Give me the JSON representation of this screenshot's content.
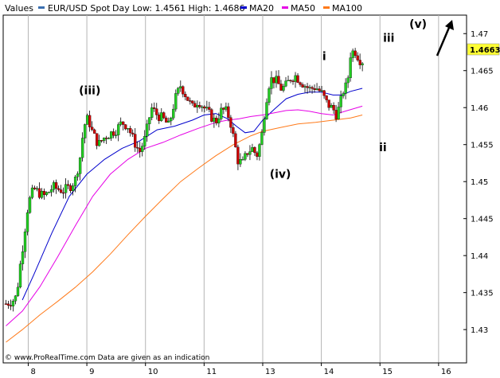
{
  "header": {
    "values_label": "Values",
    "symbol": "EUR/USD Spot",
    "day_low_high": "Day Low: 1.4561 High: 1.4686",
    "ma20_label": "MA20",
    "ma50_label": "MA50",
    "ma100_label": "MA100"
  },
  "colors": {
    "symbol": "#3a6fb0",
    "ma20": "#0000cc",
    "ma50": "#e600e6",
    "ma100": "#ff7a1a",
    "bull": "#22cc22",
    "bear": "#cc0000",
    "wick": "#000000",
    "last_price_bg": "#ffff33"
  },
  "last_price": "1.4663",
  "copyright": "© www.ProRealTime.com Data are given as an indication",
  "chart_data": {
    "type": "candlestick",
    "ylim": [
      1.4255,
      1.4725
    ],
    "y_ticks": [
      "1.47",
      "1.465",
      "1.46",
      "1.455",
      "1.45",
      "1.445",
      "1.44",
      "1.435",
      "1.43"
    ],
    "x_ticks": [
      "8",
      "9",
      "10",
      "11",
      "13",
      "14",
      "15",
      "16"
    ],
    "x_tick_positions": [
      8,
      9,
      10,
      11,
      12,
      13,
      14,
      15
    ],
    "x_domain": [
      7.6,
      15.45
    ],
    "annotations": [
      {
        "text": "(iii)",
        "x": 9.05,
        "y": 1.4618
      },
      {
        "text": "i",
        "x": 13.05,
        "y": 1.4664
      },
      {
        "text": "(iv)",
        "x": 12.3,
        "y": 1.4505
      },
      {
        "text": "iii",
        "x": 14.15,
        "y": 1.4689
      },
      {
        "text": "ii",
        "x": 14.05,
        "y": 1.4541
      },
      {
        "text": "(v)",
        "x": 14.65,
        "y": 1.4708
      }
    ],
    "candle_anchors": [
      [
        7.62,
        1.4335
      ],
      [
        7.72,
        1.4338
      ],
      [
        7.8,
        1.4345
      ],
      [
        7.86,
        1.4385
      ],
      [
        7.92,
        1.442
      ],
      [
        7.98,
        1.446
      ],
      [
        8.04,
        1.448
      ],
      [
        8.1,
        1.449
      ],
      [
        8.18,
        1.4485
      ],
      [
        8.26,
        1.448
      ],
      [
        8.34,
        1.4485
      ],
      [
        8.42,
        1.4493
      ],
      [
        8.5,
        1.449
      ],
      [
        8.6,
        1.4488
      ],
      [
        8.7,
        1.4492
      ],
      [
        8.8,
        1.4502
      ],
      [
        8.88,
        1.453
      ],
      [
        8.95,
        1.4575
      ],
      [
        9.02,
        1.4586
      ],
      [
        9.1,
        1.4565
      ],
      [
        9.2,
        1.455
      ],
      [
        9.3,
        1.456
      ],
      [
        9.4,
        1.4565
      ],
      [
        9.5,
        1.457
      ],
      [
        9.6,
        1.458
      ],
      [
        9.7,
        1.4575
      ],
      [
        9.8,
        1.4555
      ],
      [
        9.9,
        1.454
      ],
      [
        10.0,
        1.456
      ],
      [
        10.1,
        1.46
      ],
      [
        10.2,
        1.459
      ],
      [
        10.3,
        1.4585
      ],
      [
        10.4,
        1.4575
      ],
      [
        10.5,
        1.461
      ],
      [
        10.6,
        1.463
      ],
      [
        10.7,
        1.4615
      ],
      [
        10.8,
        1.46
      ],
      [
        10.9,
        1.461
      ],
      [
        11.0,
        1.46
      ],
      [
        11.1,
        1.459
      ],
      [
        11.2,
        1.458
      ],
      [
        11.28,
        1.4595
      ],
      [
        11.36,
        1.4597
      ],
      [
        11.44,
        1.4585
      ],
      [
        11.5,
        1.456
      ],
      [
        11.58,
        1.4528
      ],
      [
        11.66,
        1.4525
      ],
      [
        11.74,
        1.454
      ],
      [
        11.82,
        1.4545
      ],
      [
        11.9,
        1.4535
      ],
      [
        11.98,
        1.456
      ],
      [
        12.04,
        1.46
      ],
      [
        12.1,
        1.463
      ],
      [
        12.16,
        1.464
      ],
      [
        12.24,
        1.4635
      ],
      [
        12.32,
        1.4625
      ],
      [
        12.4,
        1.463
      ],
      [
        12.48,
        1.464
      ],
      [
        12.56,
        1.4643
      ],
      [
        12.64,
        1.4636
      ],
      [
        12.72,
        1.463
      ],
      [
        12.8,
        1.4625
      ],
      [
        12.9,
        1.4628
      ],
      [
        13.0,
        1.462
      ],
      [
        13.1,
        1.4605
      ],
      [
        13.2,
        1.4598
      ],
      [
        13.26,
        1.459
      ],
      [
        13.32,
        1.4605
      ],
      [
        13.38,
        1.4625
      ],
      [
        13.44,
        1.463
      ],
      [
        13.5,
        1.4675
      ],
      [
        13.58,
        1.4676
      ],
      [
        13.65,
        1.4665
      ],
      [
        13.7,
        1.4663
      ]
    ],
    "series": [
      {
        "name": "MA20",
        "points": [
          [
            7.9,
            1.434
          ],
          [
            8.1,
            1.4375
          ],
          [
            8.4,
            1.443
          ],
          [
            8.7,
            1.448
          ],
          [
            9.0,
            1.451
          ],
          [
            9.3,
            1.453
          ],
          [
            9.6,
            1.4545
          ],
          [
            9.9,
            1.4555
          ],
          [
            10.2,
            1.457
          ],
          [
            10.5,
            1.4575
          ],
          [
            10.8,
            1.4583
          ],
          [
            11.0,
            1.459
          ],
          [
            11.2,
            1.4592
          ],
          [
            11.4,
            1.4585
          ],
          [
            11.55,
            1.4575
          ],
          [
            11.7,
            1.4566
          ],
          [
            11.85,
            1.4568
          ],
          [
            12.0,
            1.4583
          ],
          [
            12.2,
            1.4598
          ],
          [
            12.4,
            1.4612
          ],
          [
            12.6,
            1.4618
          ],
          [
            12.8,
            1.4621
          ],
          [
            13.0,
            1.4621
          ],
          [
            13.2,
            1.4617
          ],
          [
            13.35,
            1.4617
          ],
          [
            13.5,
            1.4622
          ],
          [
            13.7,
            1.4626
          ]
        ]
      },
      {
        "name": "MA50",
        "points": [
          [
            7.62,
            1.4305
          ],
          [
            7.9,
            1.4325
          ],
          [
            8.2,
            1.4358
          ],
          [
            8.5,
            1.4398
          ],
          [
            8.8,
            1.444
          ],
          [
            9.1,
            1.448
          ],
          [
            9.4,
            1.451
          ],
          [
            9.7,
            1.453
          ],
          [
            10.0,
            1.4545
          ],
          [
            10.3,
            1.4553
          ],
          [
            10.6,
            1.4563
          ],
          [
            10.9,
            1.4572
          ],
          [
            11.2,
            1.458
          ],
          [
            11.4,
            1.4583
          ],
          [
            11.6,
            1.4585
          ],
          [
            11.8,
            1.4588
          ],
          [
            12.0,
            1.459
          ],
          [
            12.2,
            1.4593
          ],
          [
            12.4,
            1.4596
          ],
          [
            12.6,
            1.4597
          ],
          [
            12.8,
            1.4595
          ],
          [
            13.0,
            1.4592
          ],
          [
            13.2,
            1.459
          ],
          [
            13.4,
            1.4595
          ],
          [
            13.7,
            1.4602
          ]
        ]
      },
      {
        "name": "MA100",
        "points": [
          [
            7.62,
            1.4283
          ],
          [
            7.9,
            1.43
          ],
          [
            8.2,
            1.432
          ],
          [
            8.5,
            1.4338
          ],
          [
            8.8,
            1.4357
          ],
          [
            9.1,
            1.4378
          ],
          [
            9.4,
            1.4402
          ],
          [
            9.7,
            1.4428
          ],
          [
            10.0,
            1.4453
          ],
          [
            10.3,
            1.4477
          ],
          [
            10.6,
            1.45
          ],
          [
            10.9,
            1.4518
          ],
          [
            11.2,
            1.4535
          ],
          [
            11.5,
            1.455
          ],
          [
            11.8,
            1.4562
          ],
          [
            12.0,
            1.4568
          ],
          [
            12.3,
            1.4573
          ],
          [
            12.6,
            1.4578
          ],
          [
            12.9,
            1.458
          ],
          [
            13.2,
            1.4583
          ],
          [
            13.5,
            1.4586
          ],
          [
            13.7,
            1.459
          ]
        ]
      }
    ]
  }
}
